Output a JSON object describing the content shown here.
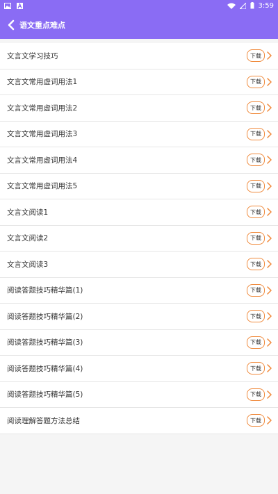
{
  "status_bar": {
    "time": "3:59",
    "left_icons": [
      "image-icon",
      "a-icon"
    ],
    "right_icons": [
      "wifi-icon",
      "signal-icon",
      "battery-icon"
    ]
  },
  "app_bar": {
    "title": "语文重点难点",
    "back_icon": "back-arrow-icon",
    "bg_color": "#8a6cf4"
  },
  "list": {
    "download_label": "下载",
    "accent_color": "#f08a3c",
    "items": [
      {
        "label": "文言文学习技巧"
      },
      {
        "label": "文言文常用虚词用法1"
      },
      {
        "label": "文言文常用虚词用法2"
      },
      {
        "label": "文言文常用虚词用法3"
      },
      {
        "label": "文言文常用虚词用法4"
      },
      {
        "label": "文言文常用虚词用法5"
      },
      {
        "label": "文言文阅读1"
      },
      {
        "label": "文言文阅读2"
      },
      {
        "label": "文言文阅读3"
      },
      {
        "label": "阅读答题技巧精华篇(1)"
      },
      {
        "label": "阅读答题技巧精华篇(2)"
      },
      {
        "label": "阅读答题技巧精华篇(3)"
      },
      {
        "label": "阅读答题技巧精华篇(4)"
      },
      {
        "label": "阅读答题技巧精华篇(5)"
      },
      {
        "label": "阅读理解答题方法总结"
      }
    ]
  }
}
